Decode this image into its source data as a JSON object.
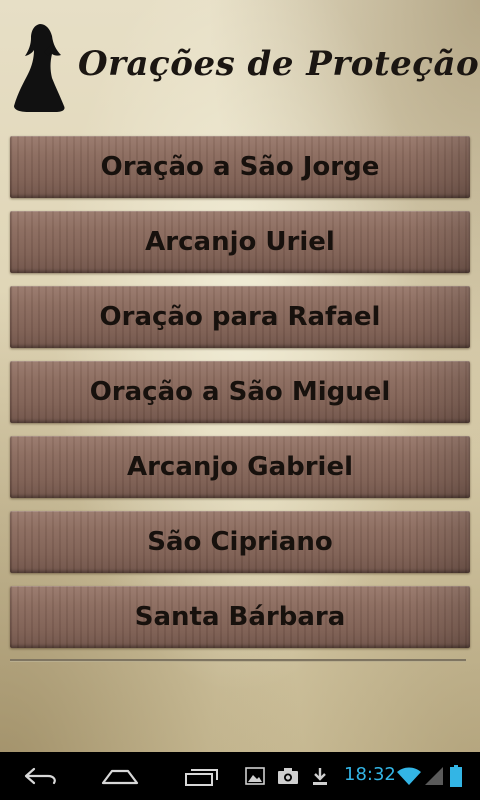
{
  "header": {
    "title": "Orações de Proteção",
    "logo_icon": "praying-nun-icon"
  },
  "menu": {
    "items": [
      {
        "label": "Oração a São Jorge"
      },
      {
        "label": "Arcanjo Uriel"
      },
      {
        "label": "Oração para Rafael"
      },
      {
        "label": "Oração a São Miguel"
      },
      {
        "label": "Arcanjo Gabriel"
      },
      {
        "label": "São Cipriano"
      },
      {
        "label": "Santa Bárbara"
      }
    ]
  },
  "navbar": {
    "buttons": [
      "back-icon",
      "home-icon",
      "recent-apps-icon"
    ],
    "notifications": [
      "gallery-icon",
      "camera-icon",
      "download-icon"
    ],
    "clock": "18:32",
    "status_icons": [
      "wifi-icon",
      "signal-icon",
      "battery-icon"
    ],
    "accent_color": "#33b5e5"
  }
}
